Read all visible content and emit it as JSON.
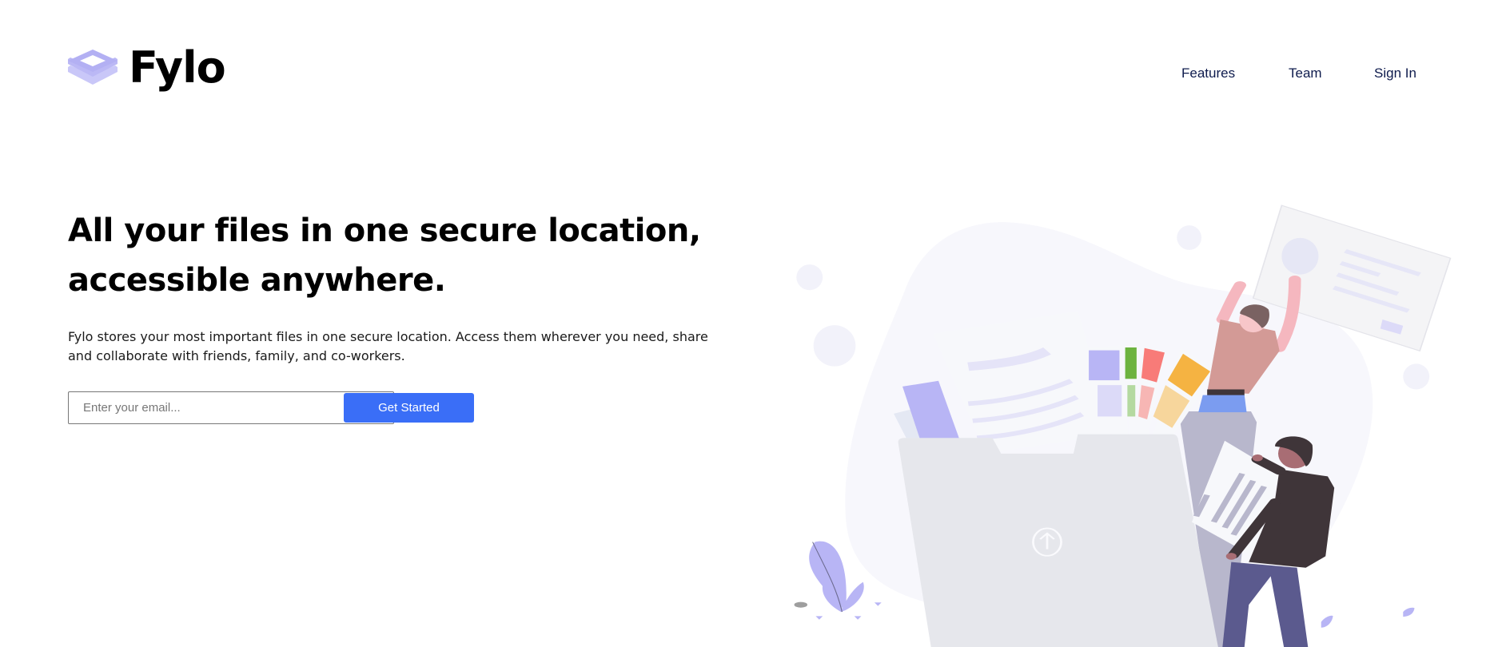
{
  "header": {
    "logo_text": "Fylo",
    "logo_icon": "stacked-layers-icon",
    "nav": [
      {
        "label": "Features"
      },
      {
        "label": "Team"
      },
      {
        "label": "Sign In"
      }
    ]
  },
  "hero": {
    "title": "All your files in one secure location, accessible anywhere.",
    "description": "Fylo stores your most important files in one secure location. Access them wherever you need, share and collaborate with friends, family, and co-workers.",
    "email_placeholder": "Enter your email...",
    "email_value": "",
    "cta_label": "Get Started",
    "illustration": "people-uploading-files-to-folder"
  },
  "colors": {
    "accent": "#3a6ef7",
    "nav_text": "#0e1b4d",
    "logo_icon": "#b8b5f5"
  }
}
